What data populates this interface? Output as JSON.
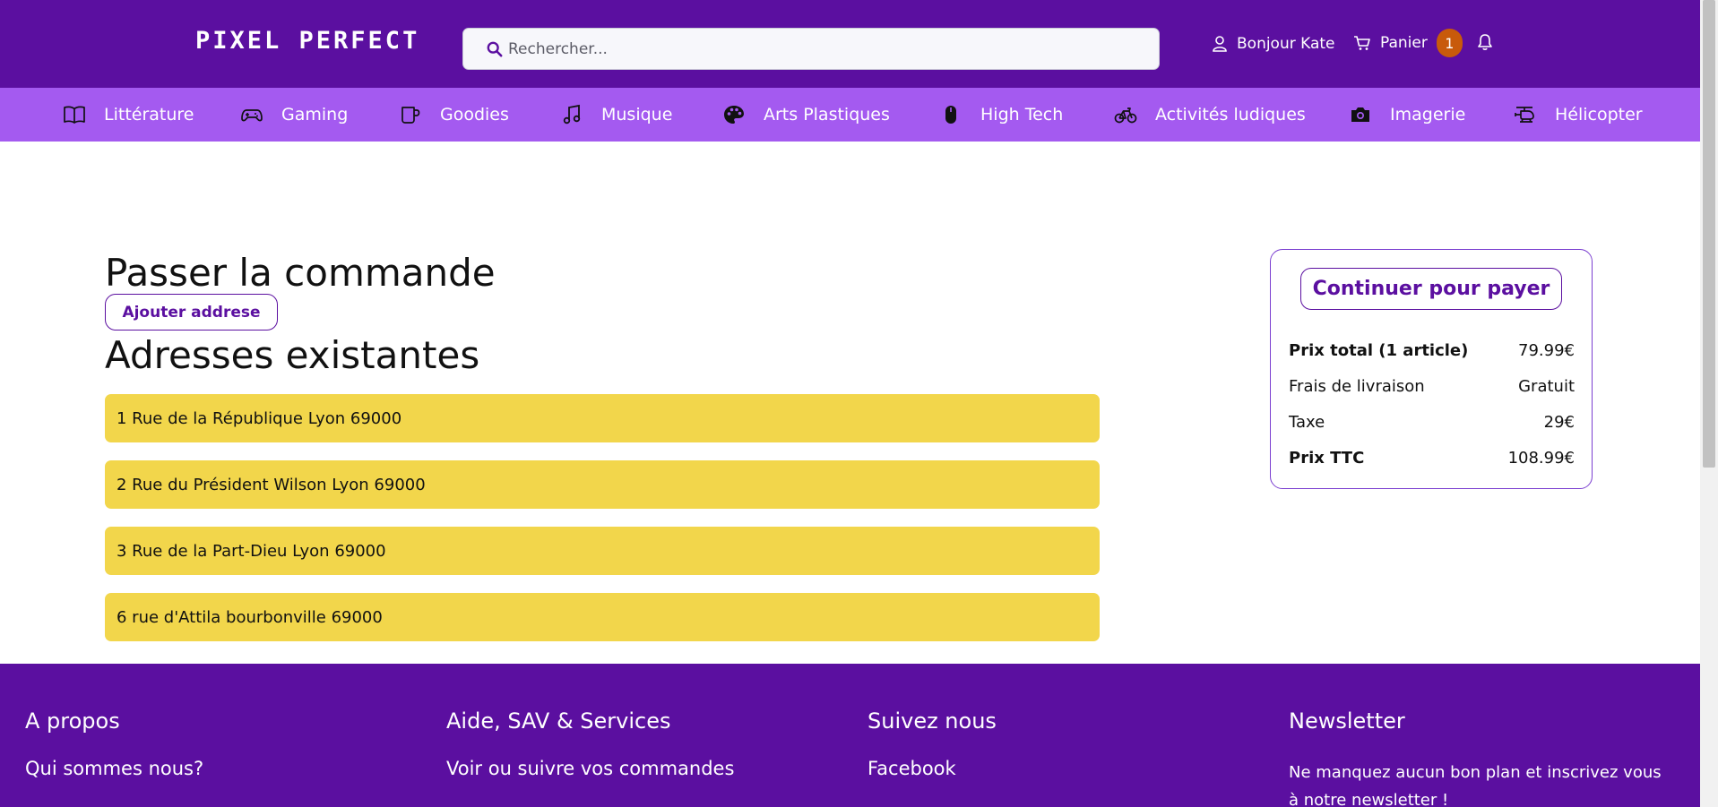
{
  "header": {
    "logo": "PIXEL PERFECT",
    "search_placeholder": "Rechercher...",
    "greeting": "Bonjour Kate",
    "cart_label": "Panier",
    "cart_count": "1",
    "icons": [
      "search-icon",
      "user-icon",
      "cart-icon",
      "bell-icon"
    ]
  },
  "categories": [
    {
      "label": "Littérature",
      "icon": "book-icon"
    },
    {
      "label": "Gaming",
      "icon": "gamepad-icon"
    },
    {
      "label": "Goodies",
      "icon": "mug-icon"
    },
    {
      "label": "Musique",
      "icon": "music-note-icon"
    },
    {
      "label": "Arts Plastiques",
      "icon": "palette-icon"
    },
    {
      "label": "High Tech",
      "icon": "mouse-icon"
    },
    {
      "label": "Activités ludiques",
      "icon": "bicycle-icon"
    },
    {
      "label": "Imagerie",
      "icon": "camera-icon"
    },
    {
      "label": "Hélicopter",
      "icon": "helicopter-icon"
    }
  ],
  "main": {
    "title": "Passer la commande",
    "add_address_label": "Ajouter addrese",
    "existing_title": "Adresses existantes",
    "addresses": [
      "1 Rue de la République Lyon 69000",
      "2 Rue du Président Wilson Lyon 69000",
      "3 Rue de la Part-Dieu Lyon 69000",
      "6 rue d'Attila bourbonville 69000"
    ]
  },
  "summary": {
    "pay_label": "Continuer pour payer",
    "rows": [
      {
        "label": "Prix total (1 article)",
        "value": "79.99€",
        "bold": true
      },
      {
        "label": "Frais de livraison",
        "value": "Gratuit",
        "bold": false
      },
      {
        "label": "Taxe",
        "value": "29€",
        "bold": false
      },
      {
        "label": "Prix TTC",
        "value": "108.99€",
        "bold": true
      }
    ]
  },
  "footer": {
    "columns": [
      {
        "title": "A propos",
        "link": "Qui sommes nous?"
      },
      {
        "title": "Aide, SAV & Services",
        "link": "Voir ou suivre vos commandes"
      },
      {
        "title": "Suivez nous",
        "link": "Facebook"
      },
      {
        "title": "Newsletter",
        "text": "Ne manquez aucun bon plan et inscrivez vous à notre newsletter !"
      }
    ]
  },
  "colors": {
    "primary": "#5b0fa0",
    "nav": "#a45af0",
    "address_bg": "#f2d64b",
    "badge": "#c85a0b"
  }
}
